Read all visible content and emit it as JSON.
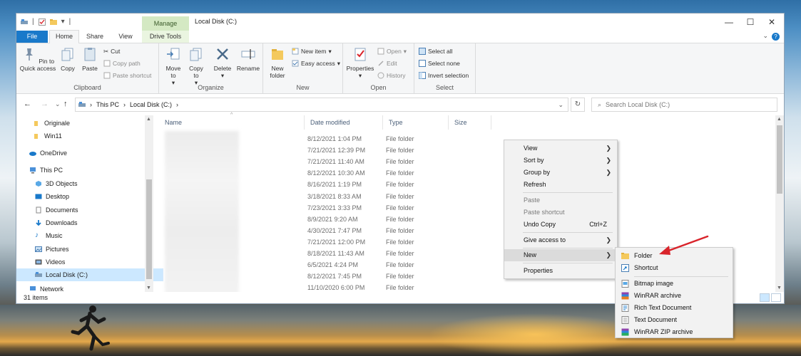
{
  "window": {
    "title": "Local Disk (C:)",
    "manage_tab": "Manage",
    "tabs": [
      "File",
      "Home",
      "Share",
      "View",
      "Drive Tools"
    ]
  },
  "ribbon": {
    "clipboard": {
      "label": "Clipboard",
      "pin": "Pin to Quick access",
      "copy": "Copy",
      "paste": "Paste",
      "cut": "Cut",
      "copy_path": "Copy path",
      "paste_shortcut": "Paste shortcut"
    },
    "organize": {
      "label": "Organize",
      "move_to": "Move to",
      "copy_to": "Copy to",
      "delete": "Delete",
      "rename": "Rename"
    },
    "new": {
      "label": "New",
      "new_folder": "New folder",
      "new_item": "New item",
      "easy_access": "Easy access"
    },
    "open": {
      "label": "Open",
      "properties": "Properties",
      "open": "Open",
      "edit": "Edit",
      "history": "History"
    },
    "select": {
      "label": "Select",
      "select_all": "Select all",
      "select_none": "Select none",
      "invert": "Invert selection"
    }
  },
  "address": {
    "path": [
      "This PC",
      "Local Disk (C:)"
    ],
    "search_placeholder": "Search Local Disk (C:)"
  },
  "nav": {
    "items": [
      "Originale",
      "Win11",
      "OneDrive",
      "This PC",
      "3D Objects",
      "Desktop",
      "Documents",
      "Downloads",
      "Music",
      "Pictures",
      "Videos",
      "Local Disk (C:)",
      "Network"
    ]
  },
  "columns": {
    "name": "Name",
    "date": "Date modified",
    "type": "Type",
    "size": "Size"
  },
  "rows": [
    {
      "date": "8/12/2021 1:04 PM",
      "type": "File folder"
    },
    {
      "date": "7/21/2021 12:39 PM",
      "type": "File folder"
    },
    {
      "date": "7/21/2021 11:40 AM",
      "type": "File folder"
    },
    {
      "date": "8/12/2021 10:30 AM",
      "type": "File folder"
    },
    {
      "date": "8/16/2021 1:19 PM",
      "type": "File folder"
    },
    {
      "date": "3/18/2021 8:33 AM",
      "type": "File folder"
    },
    {
      "date": "7/23/2021 3:33 PM",
      "type": "File folder"
    },
    {
      "date": "8/9/2021 9:20 AM",
      "type": "File folder"
    },
    {
      "date": "4/30/2021 7:47 PM",
      "type": "File folder"
    },
    {
      "date": "7/21/2021 12:00 PM",
      "type": "File folder"
    },
    {
      "date": "8/18/2021 11:43 AM",
      "type": "File folder"
    },
    {
      "date": "6/5/2021 4:24 PM",
      "type": "File folder"
    },
    {
      "date": "8/12/2021 7:45 PM",
      "type": "File folder"
    },
    {
      "date": "11/10/2020 6:00 PM",
      "type": "File folder"
    }
  ],
  "status": {
    "items": "31 items"
  },
  "context_menu": {
    "view": "View",
    "sort_by": "Sort by",
    "group_by": "Group by",
    "refresh": "Refresh",
    "paste": "Paste",
    "paste_shortcut": "Paste shortcut",
    "undo_copy": "Undo Copy",
    "undo_shortcut": "Ctrl+Z",
    "give_access": "Give access to",
    "new": "New",
    "properties": "Properties"
  },
  "new_submenu": {
    "folder": "Folder",
    "shortcut": "Shortcut",
    "bitmap": "Bitmap image",
    "winrar": "WinRAR archive",
    "rtf": "Rich Text Document",
    "txt": "Text Document",
    "winrar_zip": "WinRAR ZIP archive"
  },
  "colors": {
    "accent": "#1979ca",
    "manage_tab": "#d4e9c3",
    "selection": "#cce8ff",
    "arrow": "#d9242b"
  }
}
